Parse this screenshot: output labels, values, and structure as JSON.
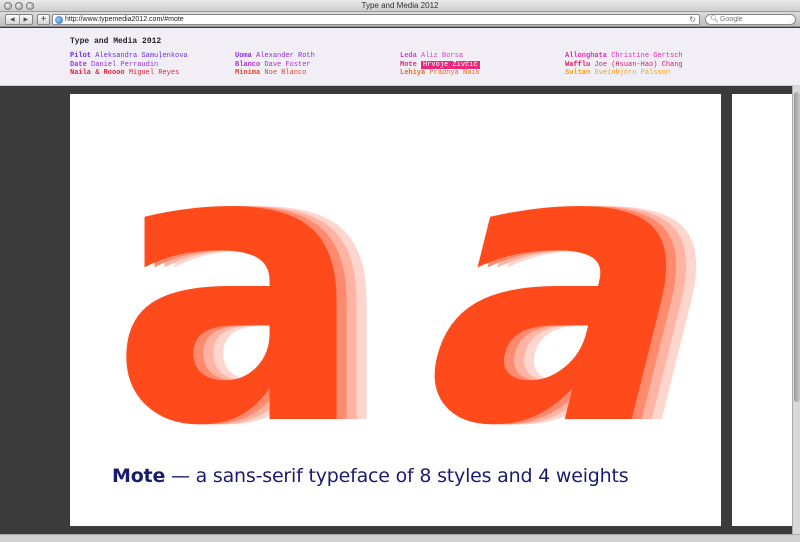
{
  "window": {
    "title": "Type and Media 2012"
  },
  "toolbar": {
    "back_icon": "◀",
    "forward_icon": "▶",
    "add_icon": "+",
    "url": "http://www.typemedia2012.com/#mote",
    "reload_icon": "↻",
    "search_placeholder": "Google"
  },
  "site": {
    "title": "Type and Media 2012",
    "fonts": [
      {
        "name": "Pilot",
        "designer": "Aleksandra Samuļenkova",
        "color": "#6a2ee6",
        "active": false
      },
      {
        "name": "Uoma",
        "designer": "Alexander Roth",
        "color": "#8a2fd8",
        "active": false
      },
      {
        "name": "Leda",
        "designer": "Aliz Borsa",
        "color": "#d43fd0",
        "active": false
      },
      {
        "name": "Allonghata",
        "designer": "Christine Gertsch",
        "color": "#e02bb5",
        "active": false
      },
      {
        "name": "Date",
        "designer": "Daniel Perraudin",
        "color": "#9b2fe0",
        "active": false
      },
      {
        "name": "Blanco",
        "designer": "Dave Foster",
        "color": "#b32fd0",
        "active": false
      },
      {
        "name": "Mote",
        "designer": "Hrvoje Živčić",
        "color": "#e8297d",
        "active": true
      },
      {
        "name": "Wafflu",
        "designer": "Joe (Hsuan-Hao) Chang",
        "color": "#d41e6a",
        "active": false
      },
      {
        "name": "Naila & Roooo",
        "designer": "Miguel Reyes",
        "color": "#e6203c",
        "active": false
      },
      {
        "name": "Minima",
        "designer": "Noe Blanco",
        "color": "#e8452a",
        "active": false
      },
      {
        "name": "Lehiya",
        "designer": "Pradnya Naik",
        "color": "#f06a1c",
        "active": false
      },
      {
        "name": "Sultan",
        "designer": "Sveinbjörn Pálsson",
        "color": "#f5a21a",
        "active": false
      }
    ]
  },
  "slide": {
    "glyph_upright": "a",
    "glyph_italic": "a",
    "glyph_color": "#ff4a1c",
    "shadow_colors": [
      "#ff8a6e",
      "#ffb4a3",
      "#ffd6cd"
    ],
    "caption_name": "Mote",
    "caption_text": " — a sans-serif typeface of 8 styles and 4 weights",
    "caption_color": "#1b1b6e"
  }
}
